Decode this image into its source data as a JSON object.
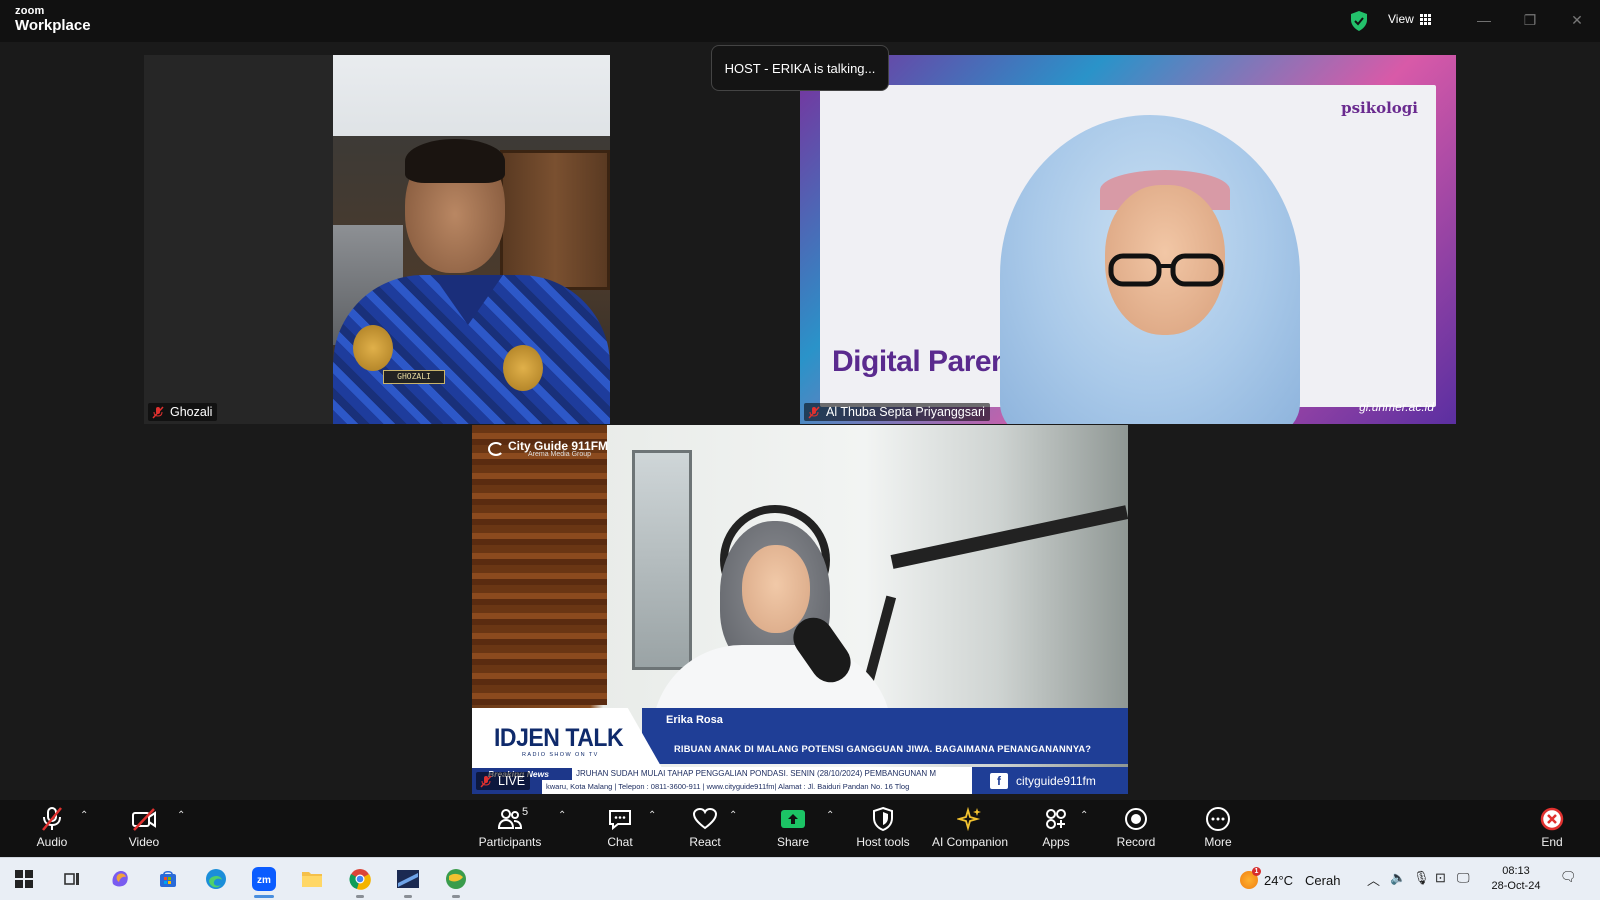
{
  "app": {
    "logo_top": "zoom",
    "logo_bottom": "Workplace",
    "view_label": "View"
  },
  "colors": {
    "accent_green": "#23c16b",
    "muted_red": "#e0312f",
    "share_green": "#1cc465",
    "toolbar_bg": "#111111"
  },
  "talking_indicator": "HOST - ERIKA is talking...",
  "participants": [
    {
      "name": "Ghozali",
      "muted": true,
      "badge_text": "GHOZALI"
    },
    {
      "name": "Al Thuba Septa Priyanggsari",
      "muted": true,
      "slide": {
        "logo": "psikologi",
        "title": "Digital Paren",
        "url": "gi.unmer.ac.id"
      }
    },
    {
      "name": "LIVE",
      "muted": true,
      "broadcast": {
        "station": "City Guide 911FM",
        "station_sub": "Arema Media Group",
        "show": "IDJEN TALK",
        "show_sub": "RADIO SHOW ON TV",
        "host": "Erika Rosa",
        "headline": "RIBUAN ANAK DI MALANG POTENSI GANGGUAN JIWA. BAGAIMANA PENANGANANNYA?",
        "breaking": "Breaking News",
        "ticker1": "JRUHAN SUDAH MULAI TAHAP PENGGALIAN PONDASI.   SENIN (28/10/2024) PEMBANGUNAN M",
        "ticker2": "kwaru, Kota Malang | Telepon : 0811-3600-911 | www.cityguide911fm| Alamat : Jl. Baiduri Pandan No. 16 Tlog",
        "social": "cityguide911fm"
      }
    }
  ],
  "toolbar": {
    "audio": "Audio",
    "video": "Video",
    "participants": "Participants",
    "participants_count": "5",
    "chat": "Chat",
    "react": "React",
    "share": "Share",
    "host_tools": "Host tools",
    "ai_companion": "AI Companion",
    "apps": "Apps",
    "record": "Record",
    "more": "More",
    "end": "End"
  },
  "taskbar": {
    "weather_temp": "24°C",
    "weather_text": "Cerah",
    "weather_alert": "1",
    "time": "08:13",
    "date": "28-Oct-24"
  }
}
